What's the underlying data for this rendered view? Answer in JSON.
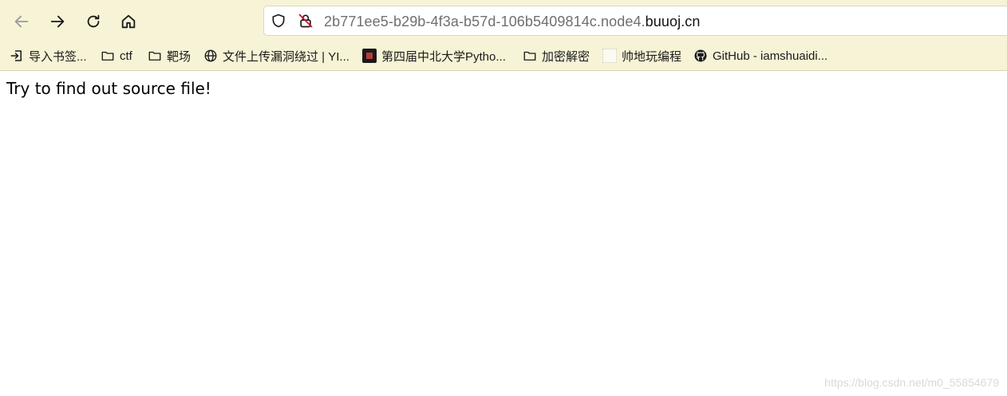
{
  "toolbar": {
    "back_icon": "arrow-left-icon",
    "forward_icon": "arrow-right-icon",
    "reload_icon": "reload-icon",
    "home_icon": "home-icon"
  },
  "urlbar": {
    "subdomain": "2b771ee5-b29b-4f3a-b57d-106b5409814c.node4.",
    "domain": "buuoj.cn",
    "shield_icon": "shield-icon",
    "insecure_icon": "insecure-lock-icon"
  },
  "bookmarks": [
    {
      "label": "导入书签...",
      "icon": "import-icon"
    },
    {
      "label": "ctf",
      "icon": "folder-icon"
    },
    {
      "label": "靶场",
      "icon": "folder-icon"
    },
    {
      "label": "文件上传漏洞绕过 | YI...",
      "icon": "globe-icon"
    },
    {
      "label": "第四届中北大学Pytho...",
      "icon": "site-favicon"
    },
    {
      "label": "加密解密",
      "icon": "folder-icon"
    },
    {
      "label": "帅地玩编程",
      "icon": "site-favicon"
    },
    {
      "label": "GitHub - iamshuaidi...",
      "icon": "github-icon"
    }
  ],
  "page": {
    "message": "Try to find out source file!"
  },
  "watermark": "https://blog.csdn.net/m0_55854679",
  "colors": {
    "chrome_background": "#f7f3d6",
    "urlbar_background": "#ffffff",
    "page_background": "#ffffff",
    "insecure_accent": "#d70022"
  }
}
